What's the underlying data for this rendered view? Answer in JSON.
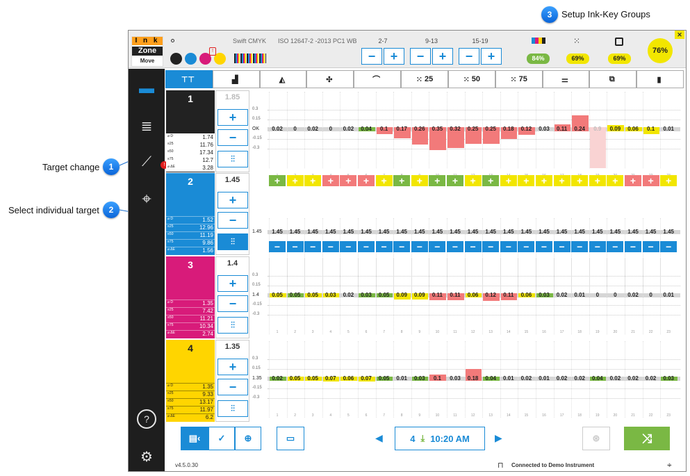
{
  "callouts": {
    "c1": {
      "num": "1",
      "label": "Target change"
    },
    "c2": {
      "num": "2",
      "label": "Select individual target"
    },
    "c3": {
      "num": "3",
      "label": "Setup Ink-Key Groups"
    }
  },
  "app": {
    "logo": {
      "l1": "I n k",
      "l2": "Zone",
      "l3": "Move"
    },
    "paper_label": "Swift CMYK",
    "standard_label": "ISO 12647-2 -2013 PC1 WB",
    "zone_groups": [
      {
        "label": "2-7"
      },
      {
        "label": "9-13"
      },
      {
        "label": "15-19"
      }
    ],
    "scores": {
      "cmyk": "84%",
      "dots": "69%",
      "overlay": "69%",
      "total": "76%"
    },
    "colors": {
      "blue": "#1a8bd6",
      "green": "#7ab844",
      "yellow": "#f2e600",
      "red": "#f27a7a",
      "cyan": "#1a8bd6",
      "magenta": "#d81b7a",
      "ink_yellow": "#ffd500",
      "black": "#222222"
    },
    "tabs": [
      {
        "icon": "overview-icon",
        "label": ""
      },
      {
        "icon": "bar-chart-icon",
        "label": ""
      },
      {
        "icon": "ink-drop-icon",
        "label": ""
      },
      {
        "icon": "registration-icon",
        "label": ""
      },
      {
        "icon": "curve-icon",
        "label": ""
      },
      {
        "icon": "dot-grid-icon",
        "label": "25"
      },
      {
        "icon": "dot-grid-icon",
        "label": "50"
      },
      {
        "icon": "dot-grid-icon",
        "label": "75"
      },
      {
        "icon": "balance-icon",
        "label": ""
      },
      {
        "icon": "overprint-icon",
        "label": ""
      },
      {
        "icon": "document-icon",
        "label": ""
      }
    ],
    "inks": [
      {
        "num": "1",
        "target": "1.85",
        "d": "1.74",
        "d25": "11.76",
        "d50": "17.34",
        "d75": "12.7",
        "de": "3.28",
        "ok_label": "OK",
        "values": [
          "0.02",
          "0",
          "0.02",
          "0",
          "0.02",
          "0.04",
          "0.1",
          "0.17",
          "0.26",
          "0.35",
          "0.32",
          "0.25",
          "0.25",
          "0.18",
          "0.12",
          "0.03",
          "0.11",
          "0.24",
          "0.9",
          "0.09",
          "0.06",
          "0.1",
          "0.01"
        ],
        "deltas": [
          0,
          0,
          0,
          0,
          0,
          0.04,
          -0.1,
          -0.17,
          -0.26,
          -0.35,
          -0.32,
          -0.25,
          -0.25,
          -0.18,
          -0.12,
          0,
          0.11,
          0.24,
          -0.9,
          0.09,
          -0.06,
          -0.1,
          0
        ],
        "colors": [
          "n",
          "n",
          "n",
          "n",
          "n",
          "g",
          "r",
          "r",
          "r",
          "r",
          "r",
          "r",
          "r",
          "r",
          "r",
          "n",
          "r",
          "r",
          "p",
          "y",
          "y",
          "y",
          "n"
        ]
      },
      {
        "num": "2",
        "target": "1.45",
        "d": "1.52",
        "d25": "12.96",
        "d50": "11.19",
        "d75": "9.86",
        "de": "1.56",
        "ok_label": "1.45",
        "values": [
          "1.45",
          "1.45",
          "1.45",
          "1.45",
          "1.45",
          "1.45",
          "1.45",
          "1.45",
          "1.45",
          "1.45",
          "1.45",
          "1.45",
          "1.45",
          "1.45",
          "1.45",
          "1.45",
          "1.45",
          "1.45",
          "1.45",
          "1.45",
          "1.45",
          "1.45",
          "1.45"
        ],
        "deltas": [
          0,
          0,
          0,
          0,
          0,
          0,
          0,
          0,
          0,
          0,
          0,
          0,
          0,
          0,
          0,
          0,
          0,
          0,
          0,
          0,
          0,
          0,
          0
        ],
        "colors": [
          "n",
          "n",
          "n",
          "n",
          "n",
          "n",
          "n",
          "n",
          "n",
          "n",
          "n",
          "n",
          "n",
          "n",
          "n",
          "n",
          "n",
          "n",
          "n",
          "n",
          "n",
          "n",
          "n"
        ]
      },
      {
        "num": "3",
        "target": "1.4",
        "d": "1.35",
        "d25": "7.42",
        "d50": "11.21",
        "d75": "10.34",
        "de": "2.74",
        "ok_label": "1.4",
        "values": [
          "0.05",
          "0.05",
          "0.05",
          "0.03",
          "0.02",
          "0.03",
          "0.05",
          "0.09",
          "0.09",
          "0.11",
          "0.11",
          "0.06",
          "0.12",
          "0.11",
          "0.06",
          "0.03",
          "0.02",
          "0.01",
          "0",
          "0",
          "0.02",
          "0",
          "0.01"
        ],
        "deltas": [
          -0.05,
          -0.05,
          -0.05,
          -0.03,
          0,
          -0.03,
          -0.05,
          -0.09,
          -0.09,
          -0.11,
          -0.11,
          -0.06,
          -0.12,
          -0.11,
          -0.06,
          -0.03,
          0,
          0,
          0,
          0,
          0,
          0,
          0
        ],
        "colors": [
          "y",
          "g",
          "y",
          "y",
          "n",
          "g",
          "g",
          "y",
          "y",
          "r",
          "r",
          "y",
          "r",
          "r",
          "y",
          "g",
          "n",
          "n",
          "n",
          "n",
          "n",
          "n",
          "n"
        ]
      },
      {
        "num": "4",
        "target": "1.35",
        "d": "1.35",
        "d25": "9.33",
        "d50": "13.17",
        "d75": "11.97",
        "de": "6.2",
        "ok_label": "1.35",
        "values": [
          "0.02",
          "0.05",
          "0.05",
          "0.07",
          "0.06",
          "0.07",
          "0.05",
          "0.01",
          "0.03",
          "0.1",
          "0.03",
          "0.18",
          "0.04",
          "0.01",
          "0.02",
          "0.01",
          "0.02",
          "0.02",
          "0.04",
          "0.02",
          "0.02",
          "0.02",
          "0.03"
        ],
        "deltas": [
          0,
          -0.05,
          -0.05,
          -0.07,
          -0.06,
          -0.07,
          -0.05,
          0,
          0.03,
          0.1,
          0,
          0.18,
          0.04,
          0,
          0,
          0,
          0,
          0,
          0.04,
          0,
          0,
          0,
          0
        ],
        "colors": [
          "g",
          "y",
          "y",
          "y",
          "y",
          "y",
          "g",
          "n",
          "g",
          "r",
          "n",
          "r",
          "g",
          "n",
          "n",
          "n",
          "n",
          "n",
          "g",
          "n",
          "n",
          "n",
          "g"
        ]
      }
    ],
    "plus_row_colors": [
      "g",
      "y",
      "y",
      "r",
      "r",
      "r",
      "y",
      "g",
      "y",
      "g",
      "g",
      "y",
      "g",
      "y",
      "y",
      "y",
      "y",
      "y",
      "y",
      "y",
      "r",
      "r",
      "y"
    ],
    "minus_row_count": 23,
    "yticks_1": [
      "0.3",
      "0.15",
      "OK",
      "-0.15",
      "-0.3"
    ],
    "yticks_2": [
      "0.3",
      "0.15",
      "1.45",
      "-0.15",
      "-0.3"
    ],
    "yticks_3": [
      "0.3",
      "0.15",
      "1.4",
      "-0.15",
      "-0.3"
    ],
    "yticks_4": [
      "0.3",
      "0.15",
      "1.35",
      "-0.15",
      "-0.3"
    ],
    "bottom": {
      "sheet_num": "4",
      "time": "10:20 AM"
    },
    "version": "v4.5.0.30",
    "connection": "Connected to Demo Instrument"
  }
}
